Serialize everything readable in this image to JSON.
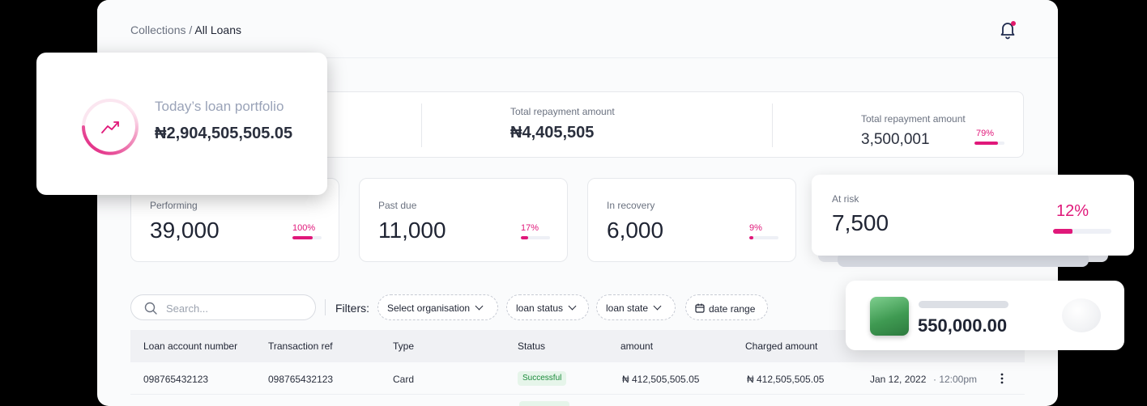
{
  "breadcrumb": {
    "parent": "Collections",
    "separator": " / ",
    "current": "All Loans"
  },
  "summary": [
    {
      "label": "Total repayment amount",
      "value": "₦4,405,505"
    },
    {
      "label": "Total repayment amount",
      "value": "3,500,001",
      "percent": "79%",
      "progress": 0.79
    }
  ],
  "cards": [
    {
      "label": "Performing",
      "value": "39,000",
      "percent": "100%",
      "progress": 0.7
    },
    {
      "label": "Past due",
      "value": "11,000",
      "percent": "17%",
      "progress": 0.25
    },
    {
      "label": "In recovery",
      "value": "6,000",
      "percent": "9%",
      "progress": 0.14
    }
  ],
  "risk": {
    "label": "At risk",
    "value": "7,500",
    "percent": "12%",
    "progress": 0.33
  },
  "portfolio": {
    "label": "Today’s loan portfolio",
    "value": "₦2,904,505,505.05"
  },
  "amount_card": {
    "value": "550,000.00"
  },
  "filters": {
    "search_placeholder": "Search...",
    "label": "Filters:",
    "organisation": "Select organisation",
    "loan_status": "loan status",
    "loan_state": "loan state",
    "date_range": "date range"
  },
  "table": {
    "headers": [
      "Loan account number",
      "Transaction ref",
      "Type",
      "Status",
      "amount",
      "Charged amount"
    ],
    "rows": [
      {
        "account": "098765432123",
        "ref": "098765432123",
        "type": "Card",
        "status": "Successful",
        "amount": "₦ 412,505,505.05",
        "charged": "₦ 412,505,505.05",
        "date": "Jan 12, 2022",
        "time": "· 12:00pm"
      }
    ]
  },
  "colors": {
    "accent": "#e0187a",
    "success": "#1b8a3a",
    "notification_dot": "#e0186a"
  },
  "icons": [
    "bell-icon",
    "trend-up-icon",
    "search-icon",
    "calendar-icon",
    "chevron-down-icon",
    "kebab-icon"
  ]
}
